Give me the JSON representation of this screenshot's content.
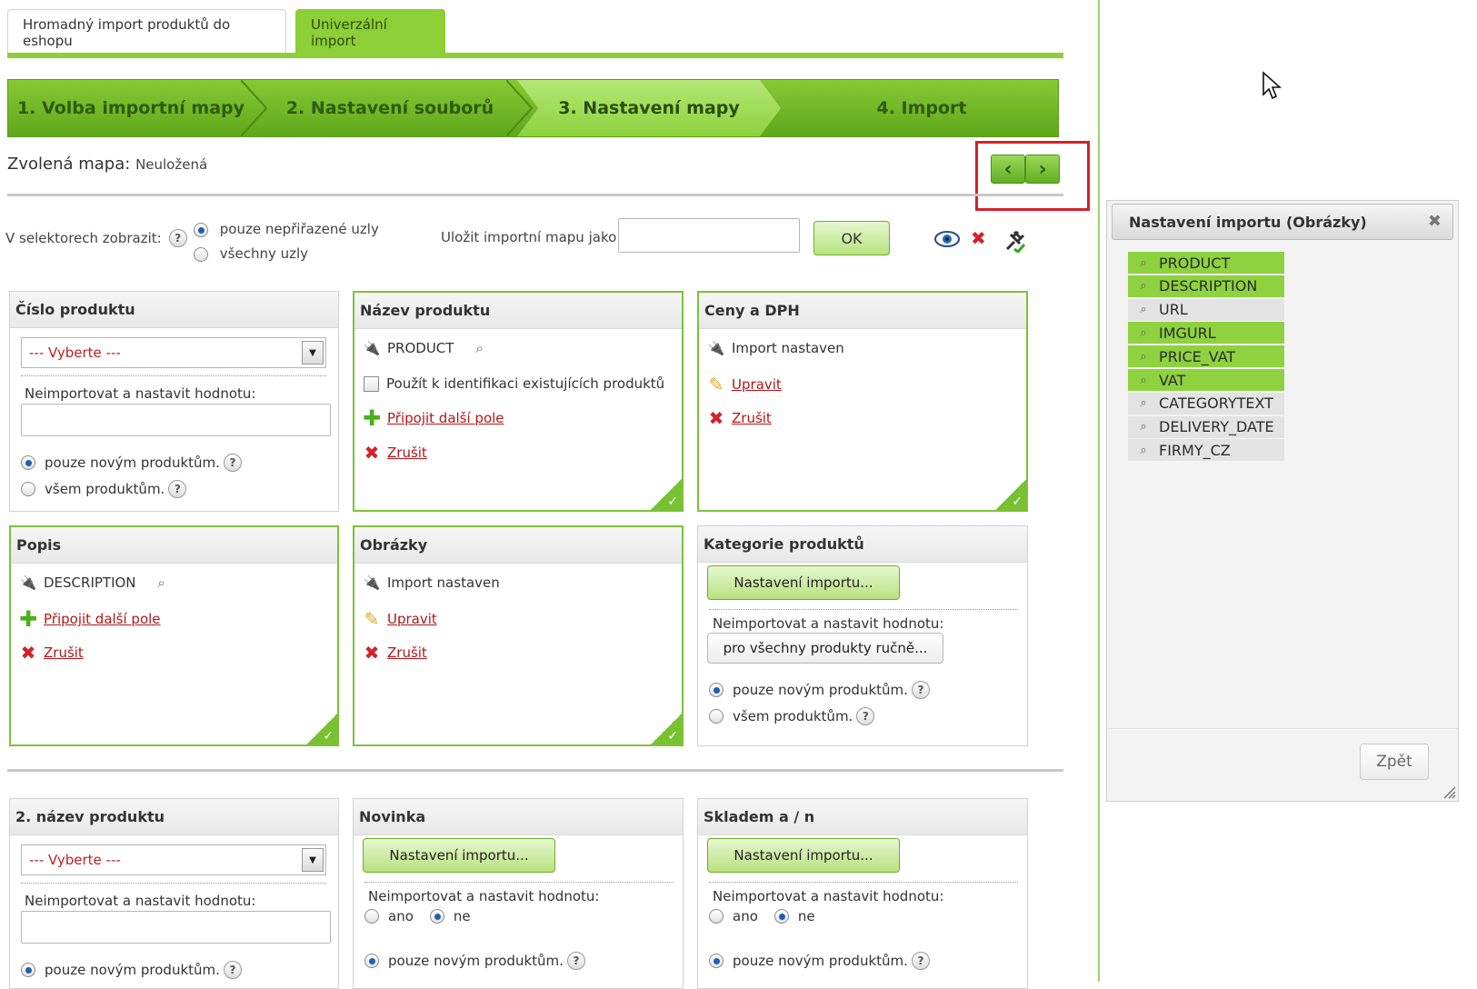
{
  "tabs": [
    {
      "label": "Hromadný import produktů do eshopu"
    },
    {
      "label": "Univerzální import"
    }
  ],
  "steps": [
    "1. Volba importní mapy",
    "2. Nastavení souborů",
    "3. Nastavení mapy",
    "4. Import"
  ],
  "map": {
    "label": "Zvolená mapa:",
    "value": "Neuložená"
  },
  "filter": {
    "label": "V selektorech zobrazit:",
    "opt1": "pouze nepřiřazené uzly",
    "opt2": "všechny uzly",
    "save_label": "Uložit importní mapu jako:",
    "ok": "OK"
  },
  "common": {
    "select_placeholder": "--- Vyberte ---",
    "no_import": "Neimportovat a nastavit hodnotu:",
    "only_new": "pouze novým produktům.",
    "all_products": "všem produktům.",
    "attach": "Připojit další pole",
    "cancel": "Zrušit",
    "edit": "Upravit",
    "import_set": "Import nastaven",
    "settings_btn": "Nastavení importu...",
    "manual_btn": "pro všechny produkty ručně...",
    "yes": "ano",
    "no": "ne",
    "help": "?"
  },
  "panels": {
    "cislo": {
      "title": "Číslo produktu"
    },
    "nazev": {
      "title": "Název produktu",
      "field": "PRODUCT",
      "identify": "Použít k identifikaci existujících produktů"
    },
    "ceny": {
      "title": "Ceny a DPH"
    },
    "popis": {
      "title": "Popis",
      "field": "DESCRIPTION"
    },
    "obrazky": {
      "title": "Obrázky"
    },
    "kategorie": {
      "title": "Kategorie produktů"
    },
    "nazev2": {
      "title": "2. název produktu"
    },
    "novinka": {
      "title": "Novinka"
    },
    "skladem": {
      "title": "Skladem a / n"
    }
  },
  "side": {
    "title": "Nastavení importu (Obrázky)",
    "fields": [
      {
        "name": "PRODUCT",
        "assigned": true
      },
      {
        "name": "DESCRIPTION",
        "assigned": true
      },
      {
        "name": "URL",
        "assigned": false
      },
      {
        "name": "IMGURL",
        "assigned": true
      },
      {
        "name": "PRICE_VAT",
        "assigned": true
      },
      {
        "name": "VAT",
        "assigned": true
      },
      {
        "name": "CATEGORYTEXT",
        "assigned": false
      },
      {
        "name": "DELIVERY_DATE",
        "assigned": false
      },
      {
        "name": "FIRMY_CZ",
        "assigned": false
      }
    ],
    "back": "Zpět"
  },
  "icons": {
    "eye": "eye-icon",
    "delete": "delete-icon",
    "plug": "plug-icon",
    "search": "search-icon",
    "nav_prev": "chevron-left-icon",
    "nav_next": "chevron-right-icon"
  },
  "colors": {
    "accent": "#8ccf36",
    "link": "#b11818",
    "highlight_box": "#d62027"
  }
}
